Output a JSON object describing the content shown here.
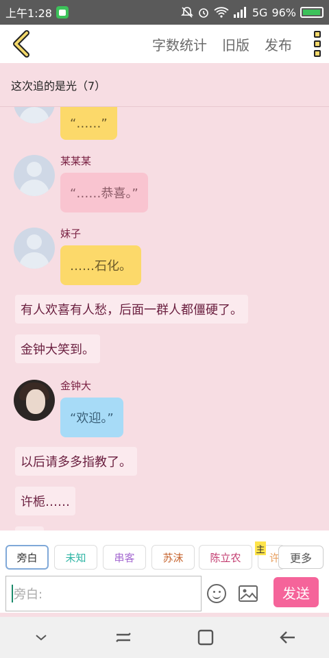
{
  "status_bar": {
    "time": "上午1:28",
    "network": "5G",
    "battery_percent": "96%",
    "battery_level": 0.96
  },
  "toolbar": {
    "actions": [
      "字数统计",
      "旧版",
      "发布"
    ]
  },
  "chapter": {
    "title": "这次追的是光（7）"
  },
  "messages": [
    {
      "type": "bubble",
      "speaker": "",
      "text": "“……”",
      "color": "yellow",
      "avatar": "default"
    },
    {
      "type": "bubble",
      "speaker": "某某某",
      "text": "“……恭喜。”",
      "color": "pink",
      "avatar": "default"
    },
    {
      "type": "bubble",
      "speaker": "妹子",
      "text": "……石化。",
      "color": "yellow",
      "avatar": "default"
    },
    {
      "type": "narration",
      "text": "有人欢喜有人愁，后面一群人都僵硬了。"
    },
    {
      "type": "narration",
      "text": "金钟大笑到。"
    },
    {
      "type": "bubble",
      "speaker": "金钟大",
      "text": "“欢迎。”",
      "color": "blue",
      "avatar": "photo"
    },
    {
      "type": "narration",
      "text": "以后请多多指教了。"
    },
    {
      "type": "narration",
      "text": "许栀……"
    }
  ],
  "roles": {
    "items": [
      {
        "label": "旁白",
        "color": "#333333",
        "active": true
      },
      {
        "label": "未知",
        "color": "#2bb3a3",
        "active": false
      },
      {
        "label": "串客",
        "color": "#a56ad1",
        "active": false
      },
      {
        "label": "苏沫",
        "color": "#c6642f",
        "active": false
      },
      {
        "label": "陈立农",
        "color": "#c23a6e",
        "active": false
      },
      {
        "label": "许",
        "color": "#e8a060",
        "active": false
      }
    ],
    "main_tag": "主",
    "more_label": "更多"
  },
  "composer": {
    "placeholder": "旁白:",
    "send_label": "发送"
  },
  "colors": {
    "accent": "#f5649a",
    "background": "#f7dde3",
    "speaker_name": "#7a2244"
  }
}
